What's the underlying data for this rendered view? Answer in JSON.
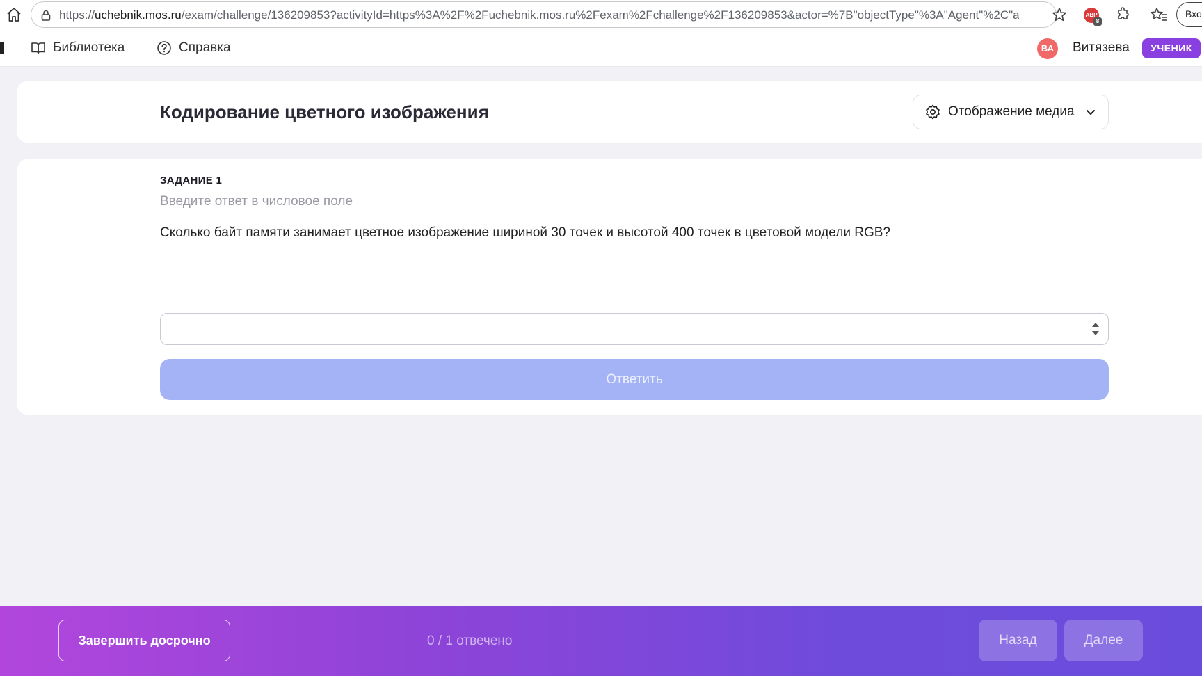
{
  "browser": {
    "url_prefix": "https://",
    "url_host": "uchebnik.mos.ru",
    "url_rest": "/exam/challenge/136209853?activityId=https%3A%2F%2Fuchebnik.mos.ru%2Fexam%2Fchallenge%2F136209853&actor=%7B\"objectType\"%3A\"Agent\"%2C\"a...",
    "adblock_label": "ABP",
    "adblock_count": "8",
    "signin_label": "Вхо"
  },
  "header": {
    "nav": [
      {
        "label": "Библиотека",
        "icon": "book-icon"
      },
      {
        "label": "Справка",
        "icon": "help-circle-icon"
      }
    ],
    "avatar_initials": "ВА",
    "user_name": "Витязева",
    "role_badge": "УЧЕНИК"
  },
  "title_card": {
    "title": "Кодирование цветного изображения",
    "media_dropdown_label": "Отображение медиа"
  },
  "task": {
    "number": "ЗАДАНИЕ 1",
    "hint": "Введите ответ в числовое поле",
    "question": "Сколько байт памяти занимает цветное изображение шириной 30 точек и высотой 400 точек в цветовой модели RGB?",
    "answer_value": "",
    "submit_label": "Ответить"
  },
  "footer": {
    "finish_label": "Завершить досрочно",
    "progress": "0 / 1 отвечено",
    "back_label": "Назад",
    "next_label": "Далее"
  },
  "colors": {
    "accent_purple": "#8a3fe0",
    "submit_disabled": "#a3b3f6",
    "footer_gradient_start": "#b246dc",
    "footer_gradient_end": "#6a4cdc"
  }
}
